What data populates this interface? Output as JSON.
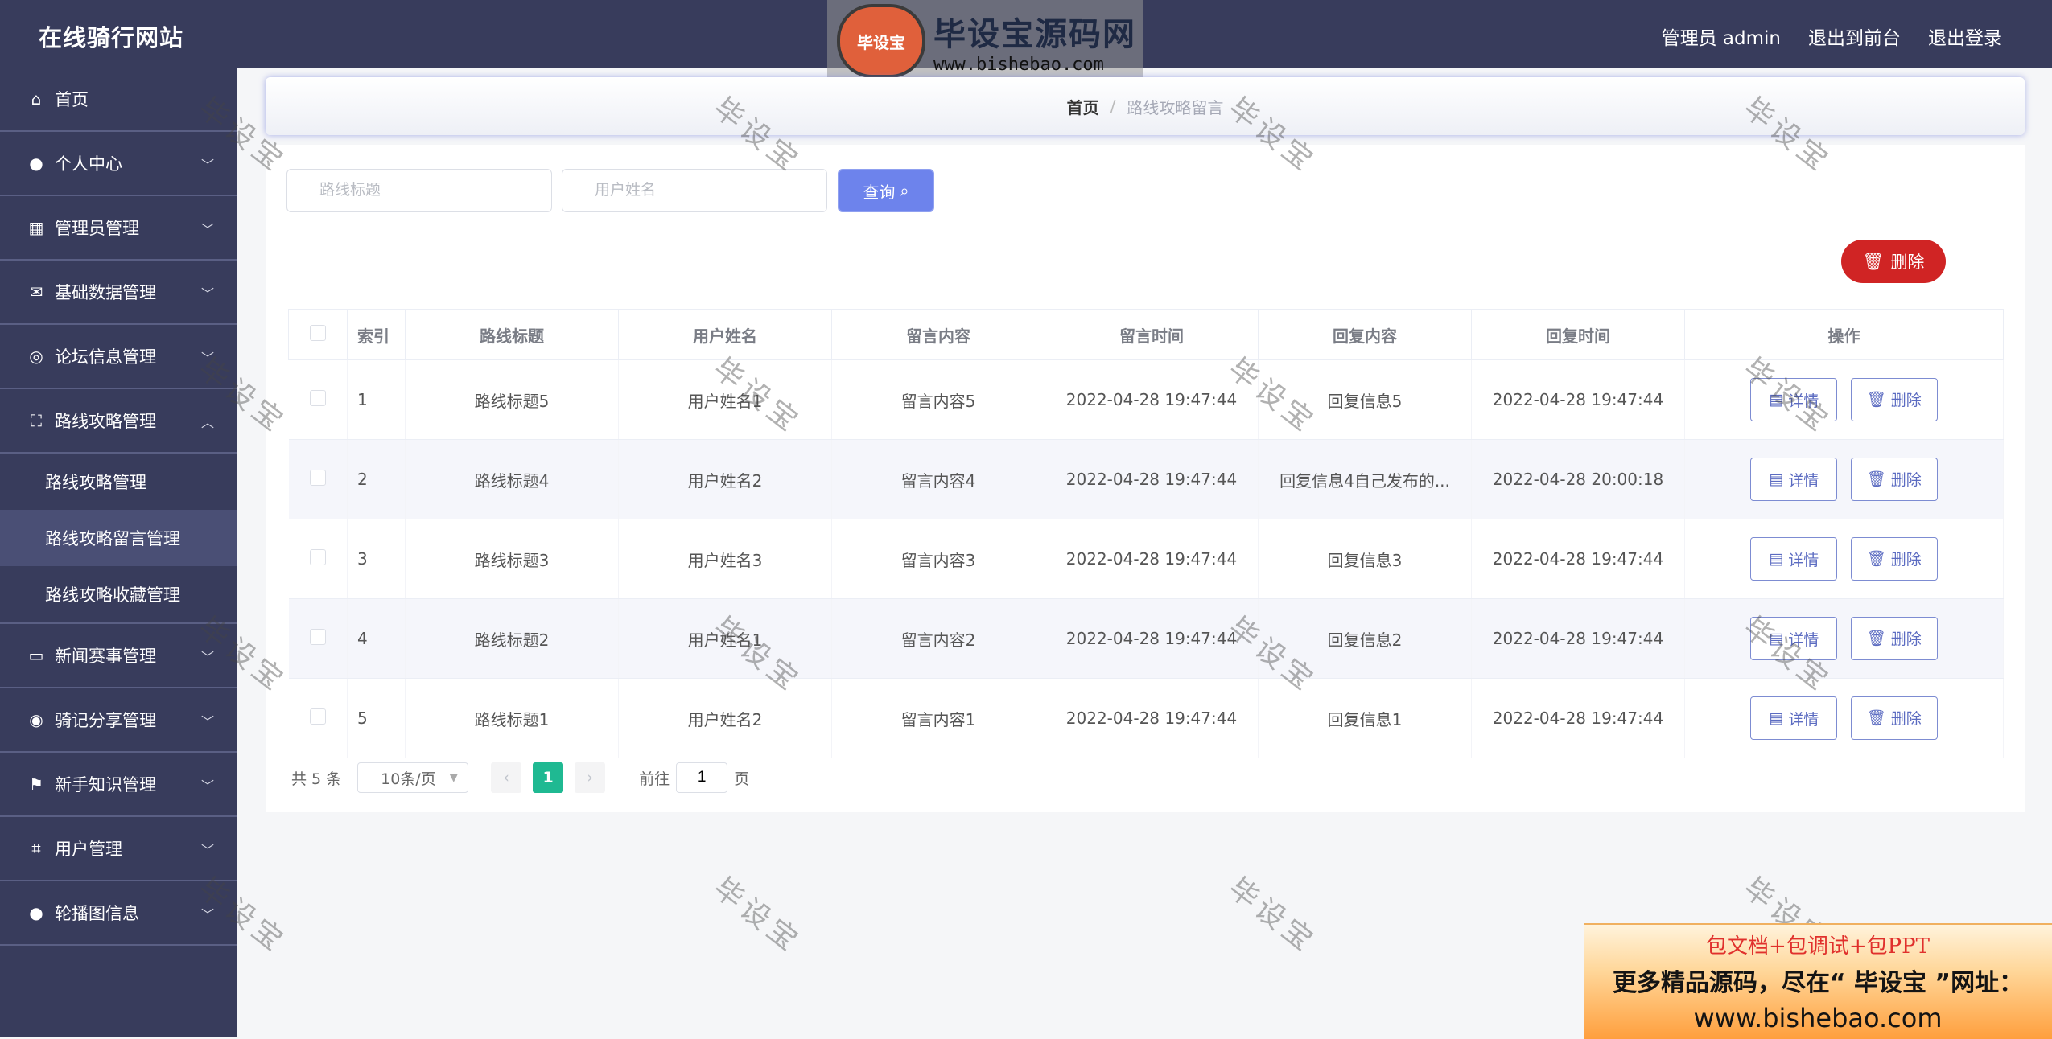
{
  "header": {
    "site_title": "在线骑行网站",
    "user_label": "管理员 admin",
    "front_link": "退出到前台",
    "logout_link": "退出登录"
  },
  "watermark_logo": {
    "badge": "毕设宝",
    "title": "毕设宝源码网",
    "url": "www.bishebao.com"
  },
  "sidebar": {
    "items": [
      {
        "label": "首页",
        "icon": "home-icon"
      },
      {
        "label": "个人中心",
        "icon": "user-icon"
      },
      {
        "label": "管理员管理",
        "icon": "grid-icon"
      },
      {
        "label": "基础数据管理",
        "icon": "mail-icon"
      },
      {
        "label": "论坛信息管理",
        "icon": "compass-icon"
      },
      {
        "label": "路线攻略管理",
        "icon": "fullscreen-icon"
      },
      {
        "label": "新闻赛事管理",
        "icon": "chat-icon"
      },
      {
        "label": "骑记分享管理",
        "icon": "target-icon"
      },
      {
        "label": "新手知识管理",
        "icon": "flag-icon"
      },
      {
        "label": "用户管理",
        "icon": "crop-icon"
      },
      {
        "label": "轮播图信息",
        "icon": "user-icon"
      }
    ],
    "sub_items": [
      "路线攻略管理",
      "路线攻略留言管理",
      "路线攻略收藏管理"
    ]
  },
  "breadcrumb": {
    "home": "首页",
    "separator": "/",
    "current": "路线攻略留言"
  },
  "search": {
    "title_placeholder": "路线标题",
    "user_placeholder": "用户姓名",
    "query_button": "查询"
  },
  "toolbar": {
    "delete_label": "删除"
  },
  "table": {
    "columns": [
      "索引",
      "路线标题",
      "用户姓名",
      "留言内容",
      "留言时间",
      "回复内容",
      "回复时间",
      "操作"
    ],
    "rows": [
      {
        "index": "1",
        "title": "路线标题5",
        "user": "用户姓名1",
        "content": "留言内容5",
        "time": "2022-04-28 19:47:44",
        "reply": "回复信息5",
        "reply_time": "2022-04-28 19:47:44"
      },
      {
        "index": "2",
        "title": "路线标题4",
        "user": "用户姓名2",
        "content": "留言内容4",
        "time": "2022-04-28 19:47:44",
        "reply": "回复信息4自己发布的...",
        "reply_time": "2022-04-28 20:00:18"
      },
      {
        "index": "3",
        "title": "路线标题3",
        "user": "用户姓名3",
        "content": "留言内容3",
        "time": "2022-04-28 19:47:44",
        "reply": "回复信息3",
        "reply_time": "2022-04-28 19:47:44"
      },
      {
        "index": "4",
        "title": "路线标题2",
        "user": "用户姓名1",
        "content": "留言内容2",
        "time": "2022-04-28 19:47:44",
        "reply": "回复信息2",
        "reply_time": "2022-04-28 19:47:44"
      },
      {
        "index": "5",
        "title": "路线标题1",
        "user": "用户姓名2",
        "content": "留言内容1",
        "time": "2022-04-28 19:47:44",
        "reply": "回复信息1",
        "reply_time": "2022-04-28 19:47:44"
      }
    ],
    "detail_label": "详情",
    "delete_label": "删除"
  },
  "pagination": {
    "total": "共 5 条",
    "page_size": "10条/页",
    "current_page": "1",
    "goto_prefix": "前往",
    "goto_value": "1",
    "goto_suffix": "页"
  },
  "watermark_text": "毕设宝",
  "ad": {
    "line1": "包文档+包调试+包PPT",
    "line2": "更多精品源码，尽在“ 毕设宝 ”网址：",
    "line3": "www.bishebao.com"
  },
  "colors": {
    "sidebar_bg": "#383c5c",
    "primary": "#6d83ec",
    "danger": "#d02424",
    "page_active": "#1fb992"
  }
}
